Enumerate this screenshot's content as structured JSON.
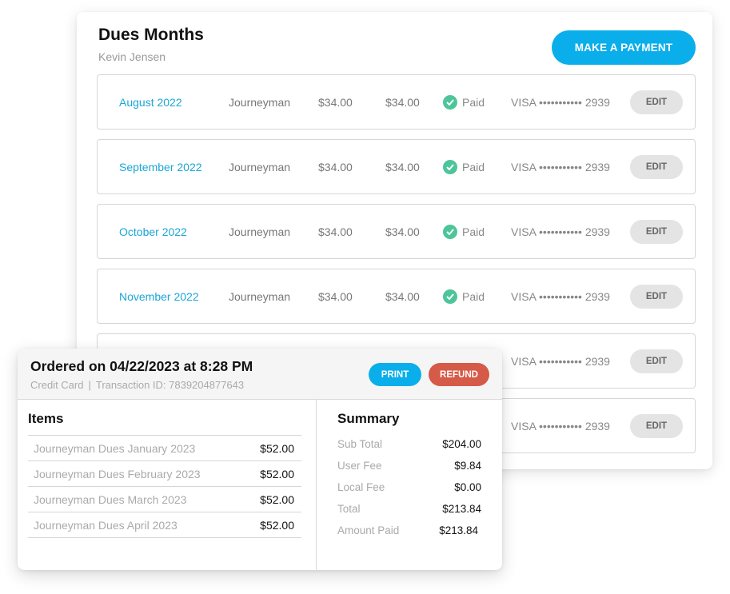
{
  "dues": {
    "title": "Dues Months",
    "member_name": "Kevin Jensen",
    "make_payment_label": "MAKE A PAYMENT",
    "rows": [
      {
        "month": "August 2022",
        "type": "Journeyman",
        "amount": "$34.00",
        "paid_amount": "$34.00",
        "status": "Paid",
        "card": "VISA ••••••••••• 2939",
        "edit_label": "EDIT"
      },
      {
        "month": "September 2022",
        "type": "Journeyman",
        "amount": "$34.00",
        "paid_amount": "$34.00",
        "status": "Paid",
        "card": "VISA ••••••••••• 2939",
        "edit_label": "EDIT"
      },
      {
        "month": "October 2022",
        "type": "Journeyman",
        "amount": "$34.00",
        "paid_amount": "$34.00",
        "status": "Paid",
        "card": "VISA ••••••••••• 2939",
        "edit_label": "EDIT"
      },
      {
        "month": "November 2022",
        "type": "Journeyman",
        "amount": "$34.00",
        "paid_amount": "$34.00",
        "status": "Paid",
        "card": "VISA ••••••••••• 2939",
        "edit_label": "EDIT"
      },
      {
        "card": "VISA ••••••••••• 2939",
        "edit_label": "EDIT"
      },
      {
        "card": "VISA ••••••••••• 2939",
        "edit_label": "EDIT"
      }
    ]
  },
  "order": {
    "title": "Ordered on 04/22/2023 at 8:28 PM",
    "payment_method": "Credit Card",
    "separator": "|",
    "transaction": "Transaction ID: 7839204877643",
    "print_label": "PRINT",
    "refund_label": "REFUND",
    "items_title": "Items",
    "items": [
      {
        "name": "Journeyman Dues January 2023",
        "price": "$52.00"
      },
      {
        "name": "Journeyman Dues February 2023",
        "price": "$52.00"
      },
      {
        "name": "Journeyman Dues March 2023",
        "price": "$52.00"
      },
      {
        "name": "Journeyman Dues April 2023",
        "price": "$52.00"
      }
    ],
    "summary_title": "Summary",
    "summary": [
      {
        "label": "Sub Total",
        "value": "$204.00"
      },
      {
        "label": "User Fee",
        "value": "$9.84"
      },
      {
        "label": "Local Fee",
        "value": "$0.00"
      },
      {
        "label": "Total",
        "value": "$213.84"
      },
      {
        "label": "Amount Paid",
        "value": "$213.84"
      }
    ]
  },
  "colors": {
    "accent": "#0aaeea",
    "link": "#1aa6d6",
    "paid": "#4dc59a",
    "refund": "#d55a47"
  },
  "icons": {
    "status": "check-circle-icon"
  }
}
